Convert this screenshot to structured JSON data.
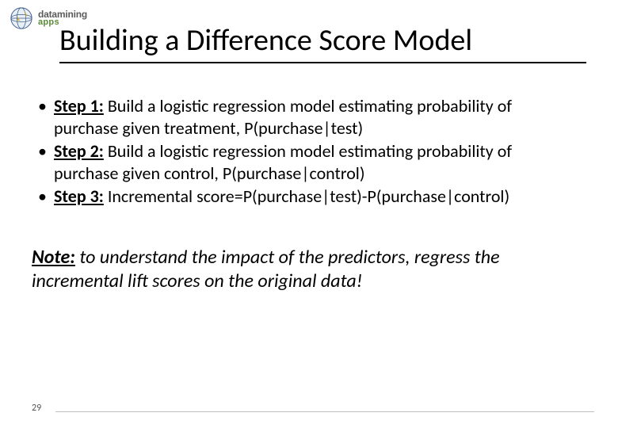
{
  "logo": {
    "brand_top": "datamining",
    "brand_bottom": "apps"
  },
  "title": "Building a Difference Score Model",
  "bullets": [
    {
      "label": "Step 1:",
      "text": " Build a logistic regression model estimating probability of purchase given treatment, P(purchase|test)"
    },
    {
      "label": "Step 2:",
      "text": " Build a logistic regression model estimating probability of purchase given control, P(purchase|control)"
    },
    {
      "label": "Step 3:",
      "text": " Incremental score=P(purchase|test)-P(purchase|control)"
    }
  ],
  "note": {
    "label": "Note:",
    "text": " to understand the impact of the predictors, regress the incremental lift scores on the original data!"
  },
  "page_number": "29"
}
